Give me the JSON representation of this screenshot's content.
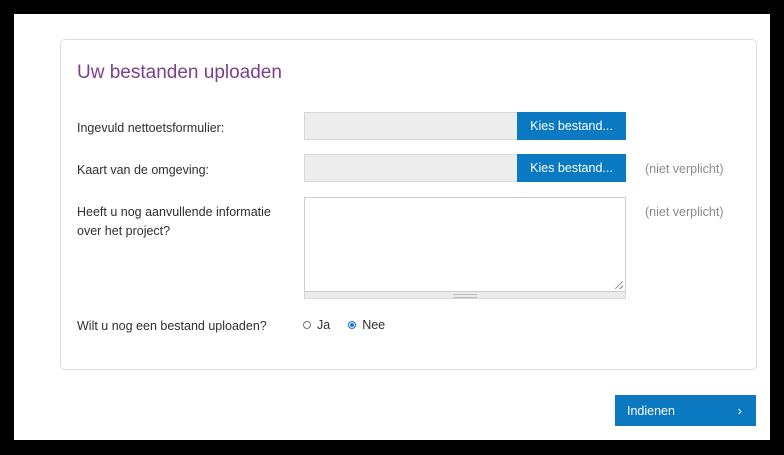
{
  "form": {
    "title": "Uw bestanden uploaden",
    "fields": [
      {
        "label": "Ingevuld nettoetsformulier:",
        "button": "Kies bestand...",
        "optional": ""
      },
      {
        "label": "Kaart van de omgeving:",
        "button": "Kies bestand...",
        "optional": "(niet verplicht)"
      }
    ],
    "extra_info": {
      "label_line1": "Heeft u nog aanvullende informatie",
      "label_line2": "over het project?",
      "optional": "(niet verplicht)",
      "value": ""
    },
    "more_upload": {
      "label": "Wilt u nog een bestand uploaden?",
      "options": [
        {
          "label": "Ja",
          "checked": false
        },
        {
          "label": "Nee",
          "checked": true
        }
      ]
    }
  },
  "submit": {
    "label": "Indienen",
    "chevron": "›"
  },
  "colors": {
    "accent": "#0b79c1",
    "title": "#7b3f8e",
    "radio_selected": "#1a73e8"
  }
}
